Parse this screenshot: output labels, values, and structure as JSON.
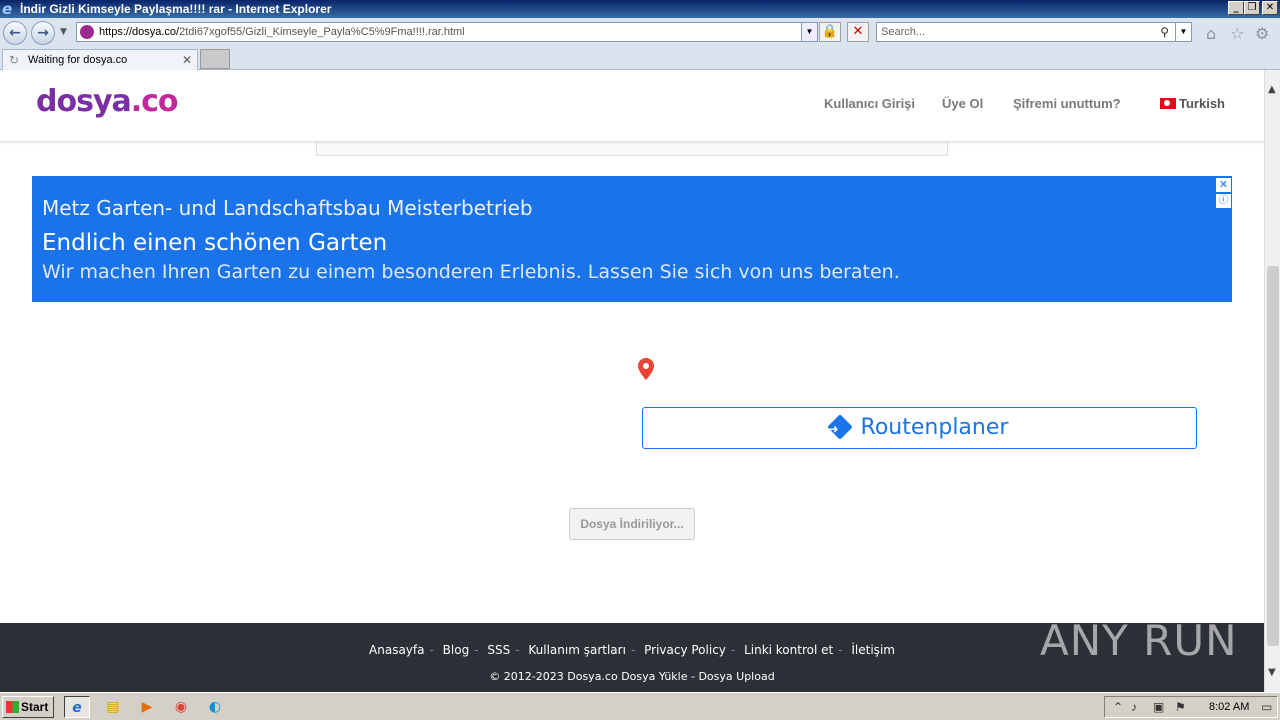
{
  "window": {
    "title": "İndir Gizli Kimseyle Paylaşma!!!! rar - Internet Explorer"
  },
  "addressbar": {
    "url_host": "https://dosya.co/",
    "url_path": "2tdi67xgof55/Gizli_Kimseyle_Payla%C5%9Fma!!!!.rar.html",
    "search_placeholder": "Search..."
  },
  "tab": {
    "label": "Waiting for dosya.co"
  },
  "site": {
    "logo_part1": "dosya",
    "logo_part2": ".co",
    "nav": [
      "Kullanıcı Girişi",
      "Üye Ol",
      "Şifremi unuttum?",
      "Turkish"
    ]
  },
  "ad": {
    "line1": "Metz Garten- und Landschaftsbau Meisterbetrieb",
    "line2": "Endlich einen schönen Garten",
    "line3": "Wir machen Ihren Garten zu einem besonderen Erlebnis. Lassen Sie sich von uns beraten.",
    "route_label": "Routenplaner",
    "brand_color": "#1a73e8"
  },
  "download": {
    "button_label": "Dosya İndiriliyor..."
  },
  "footer": {
    "links": [
      "Anasayfa",
      "Blog",
      "SSS",
      "Kullanım şartları",
      "Privacy Policy",
      "Linki kontrol et",
      "İletişim"
    ],
    "copyright": "© 2012-2023 Dosya.co Dosya Yükle - Dosya Upload"
  },
  "watermark": "ANY RUN",
  "taskbar": {
    "start_label": "Start",
    "clock": "8:02 AM"
  }
}
